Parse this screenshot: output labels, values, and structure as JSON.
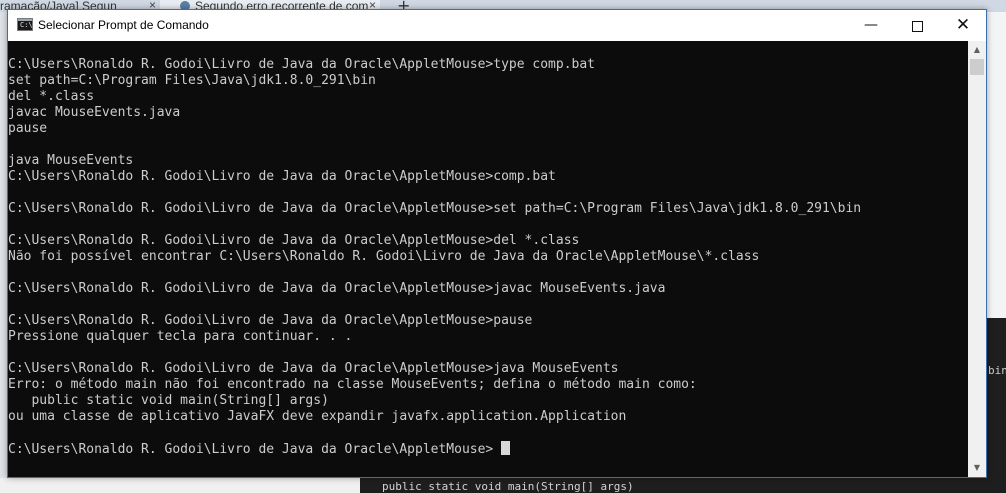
{
  "browser": {
    "tab1_title": "ramação/Java] Segun",
    "tab2_title": "Segundo erro recorrente de com",
    "new_tab": "+",
    "close_glyph": "×"
  },
  "background_doc": {
    "right_text": "bin",
    "bottom_text": "public static void main(String[] args)"
  },
  "window": {
    "title": "Selecionar Prompt de Comando",
    "icon": "cmd-icon",
    "icon_label": "C:\\",
    "minimize_glyph": "—",
    "close_glyph": "✕"
  },
  "console": {
    "lines": [
      "",
      "C:\\Users\\Ronaldo R. Godoi\\Livro de Java da Oracle\\AppletMouse>type comp.bat",
      "set path=C:\\Program Files\\Java\\jdk1.8.0_291\\bin",
      "del *.class",
      "javac MouseEvents.java",
      "pause",
      "",
      "java MouseEvents",
      "C:\\Users\\Ronaldo R. Godoi\\Livro de Java da Oracle\\AppletMouse>comp.bat",
      "",
      "C:\\Users\\Ronaldo R. Godoi\\Livro de Java da Oracle\\AppletMouse>set path=C:\\Program Files\\Java\\jdk1.8.0_291\\bin",
      "",
      "C:\\Users\\Ronaldo R. Godoi\\Livro de Java da Oracle\\AppletMouse>del *.class",
      "Não foi possível encontrar C:\\Users\\Ronaldo R. Godoi\\Livro de Java da Oracle\\AppletMouse\\*.class",
      "",
      "C:\\Users\\Ronaldo R. Godoi\\Livro de Java da Oracle\\AppletMouse>javac MouseEvents.java",
      "",
      "C:\\Users\\Ronaldo R. Godoi\\Livro de Java da Oracle\\AppletMouse>pause",
      "Pressione qualquer tecla para continuar. . .",
      "",
      "C:\\Users\\Ronaldo R. Godoi\\Livro de Java da Oracle\\AppletMouse>java MouseEvents",
      "Erro: o método main não foi encontrado na classe MouseEvents; defina o método main como:",
      "   public static void main(String[] args)",
      "ou uma classe de aplicativo JavaFX deve expandir javafx.application.Application",
      ""
    ],
    "prompt": "C:\\Users\\Ronaldo R. Godoi\\Livro de Java da Oracle\\AppletMouse> "
  },
  "scrollbar": {
    "up_glyph": "▲",
    "down_glyph": "▼"
  }
}
